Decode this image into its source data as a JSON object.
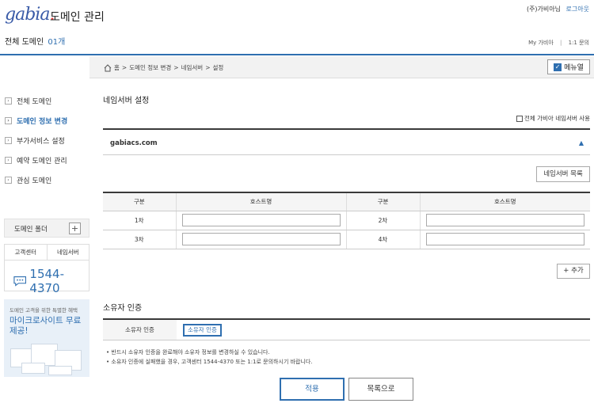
{
  "header": {
    "logo_text": "gabia",
    "logo_dot": ".",
    "title": "도메인 관리",
    "user_name": "(주)가비아님",
    "logout": "로그아웃",
    "all_domains_label": "전체 도메인",
    "all_domains_count": "01개",
    "links": [
      "My 가비아",
      "1:1 문의"
    ],
    "link_sep": "|"
  },
  "breadcrumb": {
    "items": [
      "홈",
      "도메인 정보 변경",
      "네임서버",
      "설정"
    ],
    "sep": ">",
    "menu_button": "메뉴열",
    "menu_check": "✓"
  },
  "sidebar": {
    "items": [
      {
        "label": "전체 도메인",
        "active": false
      },
      {
        "label": "도메인 정보 변경",
        "active": true
      },
      {
        "label": "부가서비스 설정",
        "active": false
      },
      {
        "label": "예약 도메인 관리",
        "active": false
      },
      {
        "label": "관심 도메인",
        "active": false
      }
    ],
    "folder_label": "도메인 폴더",
    "folder_plus": "+",
    "support_tabs": [
      "고객센터",
      "네임서버"
    ],
    "phone": "1544-4370",
    "banner_line1": "도메인 고객을 위한 특별한 혜택",
    "banner_line2": "마이크로사이트 무료 제공!"
  },
  "main": {
    "title": "네임서버 설정",
    "use_all_label": "전체 가비아 네임서버 사용",
    "domain": "gabiacs.com",
    "domain_toggle": "▲",
    "ns_list_button": "네임서버 목록",
    "table_headers": [
      "구분",
      "호스트명",
      "구분",
      "호스트명"
    ],
    "rows": [
      {
        "left": "1차",
        "right": "2차"
      },
      {
        "left": "3차",
        "right": "4차"
      }
    ],
    "add_button": "+ 추가",
    "owner_title": "소유자 인증",
    "owner_header": "소유자 인증",
    "owner_button": "소유자 인증",
    "notes": [
      "반드시 소유자 인증을 완료해야 소유자 정보를 변경하실 수 있습니다.",
      "소유자 인증에 실패했을 경우, 고객센터 1544-4370 또는 1:1로 문의하시기 바랍니다."
    ],
    "note_bullet": "•",
    "apply_button": "적용",
    "list_button": "목록으로"
  }
}
